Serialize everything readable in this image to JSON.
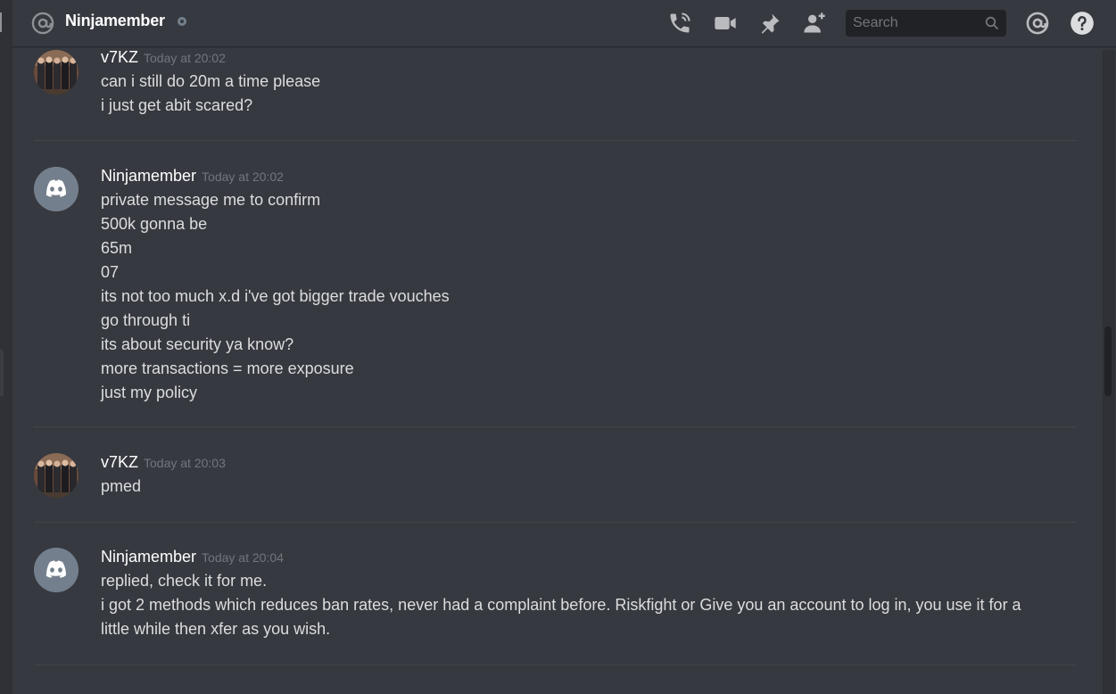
{
  "header": {
    "channel_name": "Ninjamember",
    "search_placeholder": "Search"
  },
  "icons": {
    "at": "at-icon",
    "call": "phone-call-icon",
    "video": "video-camera-icon",
    "pin": "pin-icon",
    "add_friend": "add-friend-icon",
    "search": "search-icon",
    "mentions": "mentions-icon",
    "help": "help-icon"
  },
  "colors": {
    "background": "#36393f",
    "sidebar": "#2f3136",
    "input": "#202225",
    "discord_blurple": "#7289da",
    "discord_avatar_bg": "#747f8d",
    "text": "#dcddde",
    "muted": "#72767d"
  },
  "messages": [
    {
      "author": "v7KZ",
      "timestamp": "Today at 20:02",
      "avatar": "photo",
      "lines": [
        "can i still do 20m a time please",
        "i just get abit scared?"
      ]
    },
    {
      "author": "Ninjamember",
      "timestamp": "Today at 20:02",
      "avatar": "discord-default",
      "lines": [
        "private message me to confirm",
        "500k gonna be",
        "65m",
        "07",
        "its not too much x.d i've got bigger trade vouches",
        "go through ti",
        "its about security ya know?",
        "more transactions = more exposure",
        "just my policy"
      ]
    },
    {
      "author": "v7KZ",
      "timestamp": "Today at 20:03",
      "avatar": "photo",
      "lines": [
        "pmed"
      ]
    },
    {
      "author": "Ninjamember",
      "timestamp": "Today at 20:04",
      "avatar": "discord-default",
      "lines": [
        "replied, check it for me.",
        "i got 2 methods which reduces ban rates, never had a complaint before. Riskfight or Give you an account to log in, you use it for a little while then xfer as you wish."
      ]
    }
  ]
}
